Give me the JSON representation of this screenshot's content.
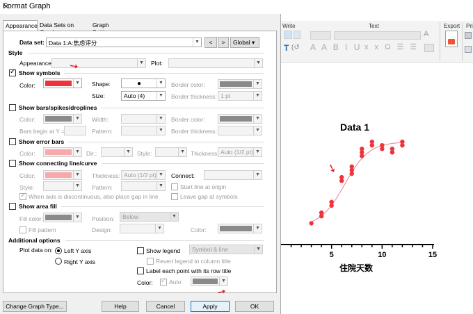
{
  "dialog": {
    "title": "Format Graph",
    "tabs": [
      "Appearance",
      "Data Sets on Graph",
      "Graph Settings"
    ],
    "dataset_label": "Data set:",
    "dataset_value": "Data 1:A:焦虑评分",
    "nav_prev": "<",
    "nav_next": ">",
    "scope": "Global",
    "style_header": "Style",
    "appearance_label": "Appearance:",
    "plot_label": "Plot:",
    "show_symbols": "Show symbols",
    "color_label": "Color:",
    "symbol_color": "#f0323a",
    "shape_label": "Shape:",
    "size_label": "Size:",
    "size_value": "Auto  (4)",
    "border_color_label": "Border color:",
    "border_thickness_label": "Border thickness:",
    "border_thickness_value": "1 pt",
    "show_bars": "Show bars/spikes/droplines",
    "width_label": "Width:",
    "bars_begin_label": "Bars begin at Y =",
    "pattern_label": "Pattern:",
    "show_error_bars": "Show error bars",
    "dir_label": "Dir.:",
    "style_label": "Style:",
    "thickness_label": "Thickness:",
    "errbar_thickness": "Auto (1/2 pt)",
    "show_connecting": "Show connecting line/curve",
    "line_thickness": "Auto (1/2 pt)",
    "connect_label": "Connect:",
    "start_line_origin": "Start line at origin",
    "leave_gap": "Leave gap at symbols",
    "axis_discontinuous": "When axis is discontinuous, also place gap in line",
    "show_area_fill": "Show area fill",
    "fill_color_label": "Fill color:",
    "position_label": "Position:",
    "position_value": "Below",
    "fill_pattern": "Fill pattern",
    "design_label": "Design:",
    "additional_header": "Additional options",
    "plot_data_on": "Plot data on:",
    "left_y": "Left Y axis",
    "right_y": "Right  Y axis",
    "show_legend": "Show legend",
    "legend_value": "Symbol & line",
    "revert_legend": "Revert legend to column title",
    "label_each_point": "Label each point with its row title",
    "label_color_label": "Color:",
    "auto_label": "Auto",
    "btn_change_type": "Change Graph Type...",
    "btn_help": "Help",
    "btn_cancel": "Cancel",
    "btn_apply": "Apply",
    "btn_ok": "OK"
  },
  "ribbon": {
    "write": "Write",
    "text": "Text",
    "export": "Export",
    "print_partial": "Pri"
  },
  "chart_data": {
    "type": "scatter",
    "title": "Data 1",
    "xlabel": "住院天数",
    "ylabel": "",
    "xlim": [
      0,
      15
    ],
    "xticks": [
      "5",
      "10",
      "15"
    ],
    "series": [
      {
        "points": [
          [
            3,
            21
          ],
          [
            4,
            23
          ],
          [
            4,
            24
          ],
          [
            5,
            26
          ],
          [
            5,
            27
          ],
          [
            6,
            33
          ],
          [
            6,
            34
          ],
          [
            7,
            35
          ],
          [
            7,
            36
          ],
          [
            7,
            37
          ],
          [
            8,
            40
          ],
          [
            8,
            41
          ],
          [
            8,
            42
          ],
          [
            9,
            44
          ],
          [
            9,
            43
          ],
          [
            10,
            43
          ],
          [
            10,
            42
          ],
          [
            11,
            41
          ],
          [
            11,
            42
          ],
          [
            12,
            43
          ],
          [
            12,
            44
          ]
        ],
        "color": "#f0323a",
        "curve": true
      }
    ]
  }
}
